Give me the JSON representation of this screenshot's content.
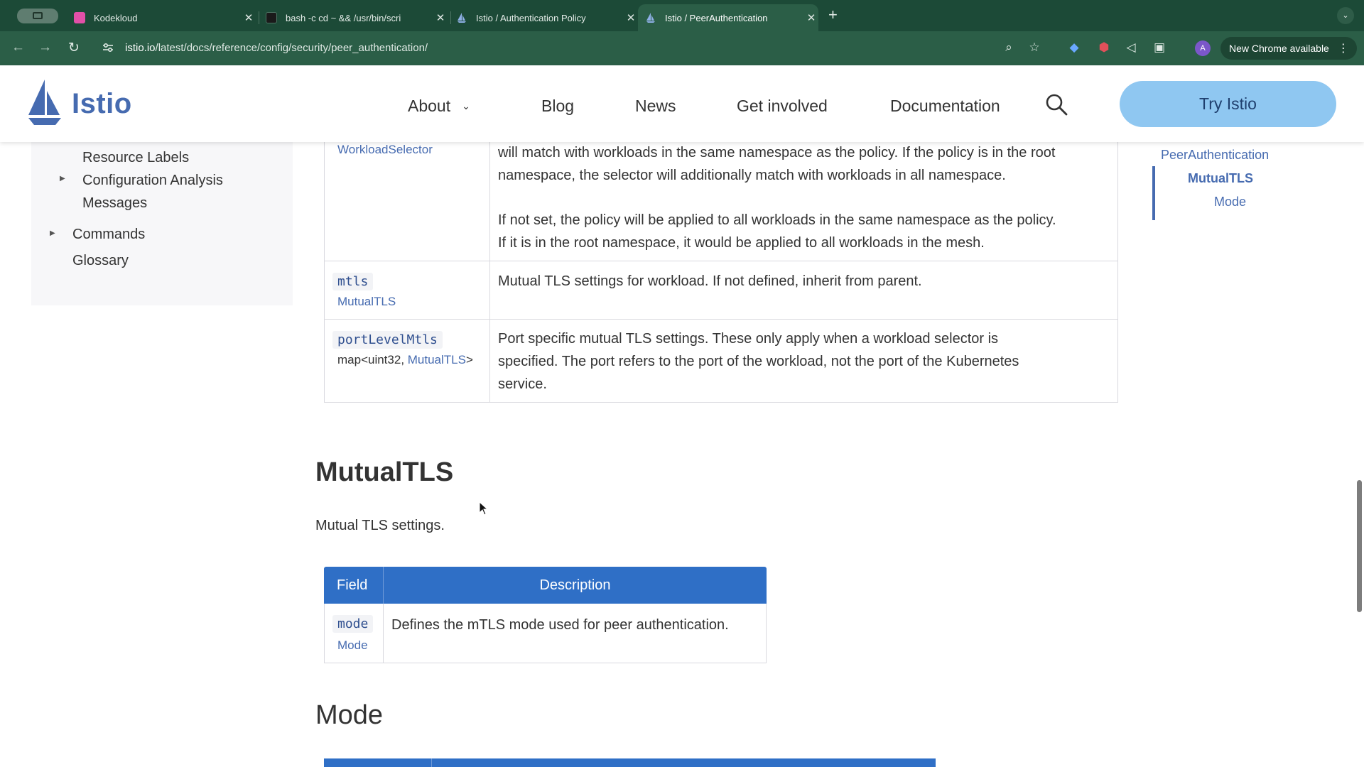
{
  "browser": {
    "tabs": [
      {
        "title": "Kodekloud",
        "favicon_color": "#e250a8"
      },
      {
        "title": "bash -c cd ~ && /usr/bin/scri",
        "favicon_color": "#1a1a1a"
      },
      {
        "title": "Istio / Authentication Policy",
        "favicon_color": "#466bb0"
      },
      {
        "title": "Istio / PeerAuthentication",
        "favicon_color": "#466bb0"
      }
    ],
    "close_glyph": "✕",
    "new_tab_glyph": "+",
    "url_host": "istio.io",
    "url_path": "/latest/docs/reference/config/security/peer_authentication/",
    "avatar_letter": "A",
    "update_label": "New Chrome available",
    "icons": [
      "back-icon",
      "forward-icon",
      "reload-icon",
      "site-settings-icon",
      "zoom-icon",
      "star-icon",
      "extension-icon",
      "mute-icon",
      "puzzle-icon",
      "menu-icon"
    ]
  },
  "site": {
    "logo_text": "Istio",
    "nav": {
      "about": "About",
      "blog": "Blog",
      "news": "News",
      "get_involved": "Get involved",
      "documentation": "Documentation"
    },
    "try_button": "Try Istio",
    "accent_color": "#466bb0",
    "button_color": "#8fc7f1",
    "table_header_color": "#2f6fc6"
  },
  "sidebar": {
    "items": {
      "resource_labels": "Resource Labels",
      "config_analysis": "Configuration Analysis",
      "config_analysis_2": "Messages",
      "commands": "Commands",
      "glossary": "Glossary"
    }
  },
  "peer_table": {
    "rows": [
      {
        "field": "",
        "type": "WorkloadSelector",
        "desc_1": "will match with workloads in the same namespace as the policy. If the policy is in the root",
        "desc_2": "namespace, the selector will additionally match with workloads in all namespace.",
        "desc_3": "If not set, the policy will be applied to all workloads in the same namespace as the policy.",
        "desc_4": "If it is in the root namespace, it would be applied to all workloads in the mesh."
      },
      {
        "field": "mtls",
        "type": "MutualTLS",
        "desc_1": "Mutual TLS settings for workload. If not defined, inherit from parent."
      },
      {
        "field": "portLevelMtls",
        "type_prefix": "map<uint32, ",
        "type_link": "MutualTLS",
        "type_suffix": ">",
        "desc_1": "Port specific mutual TLS settings. These only apply when a workload selector is",
        "desc_2": "specified. The port refers to the port of the workload, not the port of the Kubernetes",
        "desc_3": "service."
      }
    ]
  },
  "mutualtls_section": {
    "heading": "MutualTLS",
    "description": "Mutual TLS settings.",
    "table": {
      "headers": {
        "field": "Field",
        "description": "Description"
      },
      "rows": [
        {
          "field": "mode",
          "type": "Mode",
          "desc": "Defines the mTLS mode used for peer authentication."
        }
      ]
    }
  },
  "mode_section": {
    "heading": "Mode"
  },
  "toc": {
    "items": {
      "peer": "PeerAuthentication",
      "mutual": "MutualTLS",
      "mode": "Mode"
    }
  }
}
